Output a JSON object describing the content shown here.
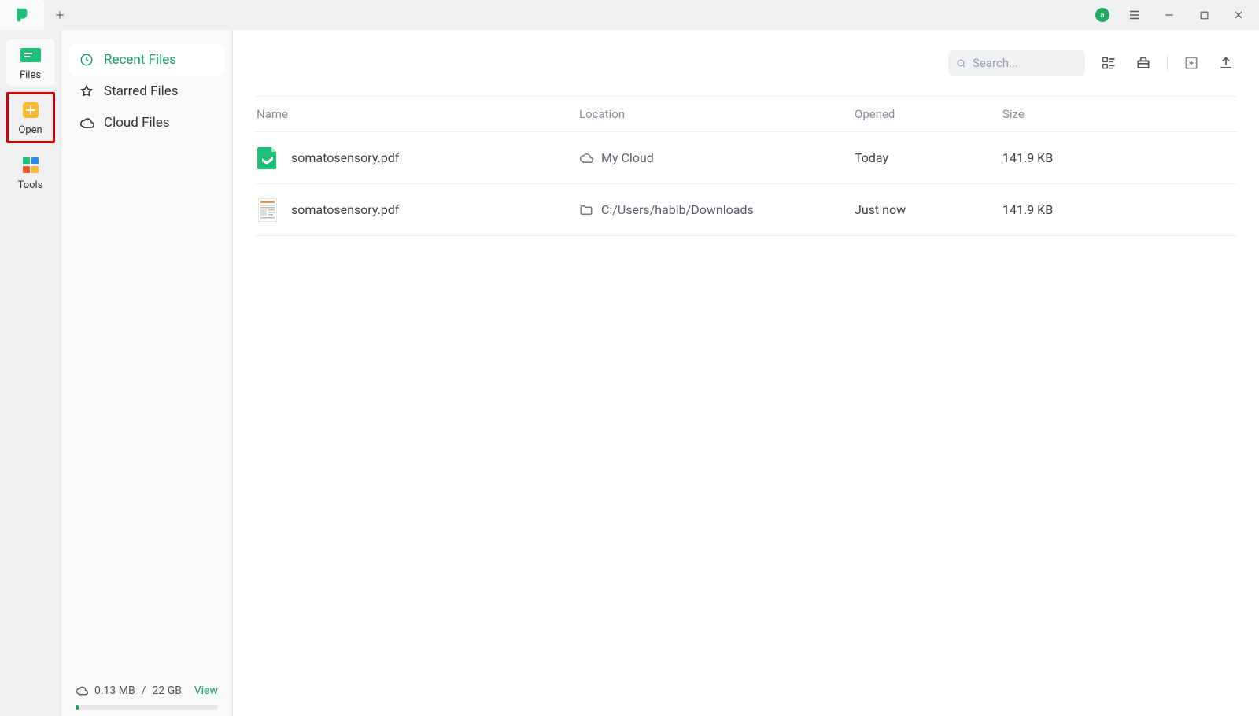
{
  "rail": {
    "files": "Files",
    "open": "Open",
    "tools": "Tools"
  },
  "nav": {
    "recent": "Recent Files",
    "starred": "Starred Files",
    "cloud": "Cloud Files"
  },
  "search": {
    "placeholder": "Search..."
  },
  "columns": {
    "name": "Name",
    "location": "Location",
    "opened": "Opened",
    "size": "Size"
  },
  "files": [
    {
      "name": "somatosensory.pdf",
      "location": "My Cloud",
      "loc_icon": "cloud",
      "opened": "Today",
      "size": "141.9 KB",
      "thumb": "app"
    },
    {
      "name": "somatosensory.pdf",
      "location": "C:/Users/habib/Downloads",
      "loc_icon": "folder",
      "opened": "Just now",
      "size": "141.9 KB",
      "thumb": "doc"
    }
  ],
  "storage": {
    "used": "0.13 MB",
    "sep": "/",
    "total": "22 GB",
    "view": "View"
  },
  "avatar_letter": "a"
}
